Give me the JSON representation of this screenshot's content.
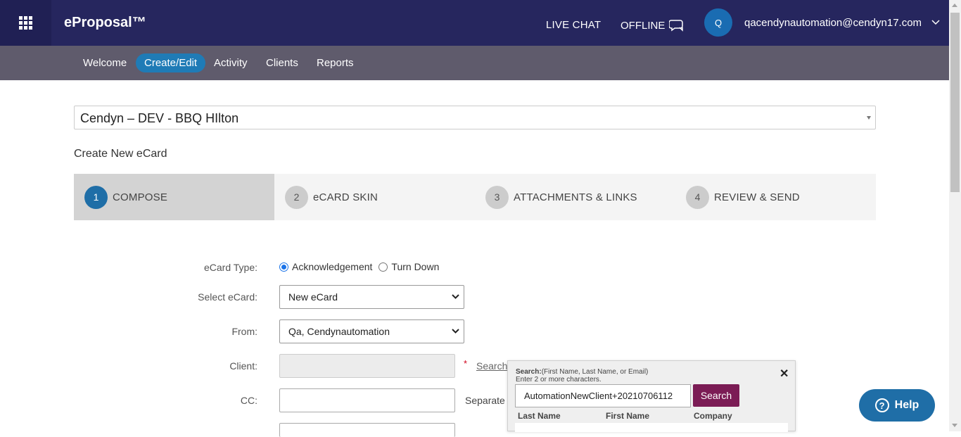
{
  "header": {
    "brand": "eProposal™",
    "live_chat": "LIVE CHAT",
    "offline": "OFFLINE",
    "avatar_initial": "Q",
    "user_email": "qacendynautomation@cendyn17.com"
  },
  "nav": {
    "items": [
      "Welcome",
      "Create/Edit",
      "Activity",
      "Clients",
      "Reports"
    ],
    "active": "Create/Edit"
  },
  "property_selector": {
    "value": "Cendyn – DEV - BBQ HIlton"
  },
  "page_title": "Create New eCard",
  "steps": [
    {
      "num": "1",
      "label": "COMPOSE",
      "active": true
    },
    {
      "num": "2",
      "label": "eCARD SKIN",
      "active": false
    },
    {
      "num": "3",
      "label": "ATTACHMENTS & LINKS",
      "active": false
    },
    {
      "num": "4",
      "label": "REVIEW & SEND",
      "active": false
    }
  ],
  "form": {
    "ecard_type_label": "eCard Type:",
    "ecard_type_options": [
      "Acknowledgement",
      "Turn Down"
    ],
    "ecard_type_selected": "Acknowledgement",
    "select_ecard_label": "Select eCard:",
    "select_ecard_value": "New eCard",
    "from_label": "From:",
    "from_value": "Qa, Cendynautomation",
    "client_label": "Client:",
    "client_value": "",
    "required_marker": "*",
    "search_link": "Search",
    "cc_label": "CC:",
    "cc_value": "",
    "cc_hint": "Separate"
  },
  "search_popup": {
    "hint_bold": "Search:",
    "hint_rest": "(First Name, Last Name, or Email)",
    "hint_line2": "Enter 2 or more characters.",
    "query": "AutomationNewClient+20210706112",
    "search_button": "Search",
    "close": "✕",
    "columns": [
      "Last Name",
      "First Name",
      "Company"
    ]
  },
  "help_button": "Help",
  "colors": {
    "topbar": "#26265e",
    "navbar": "#5f5b6c",
    "accent": "#1f7bb6",
    "search_button": "#7b1c55"
  }
}
